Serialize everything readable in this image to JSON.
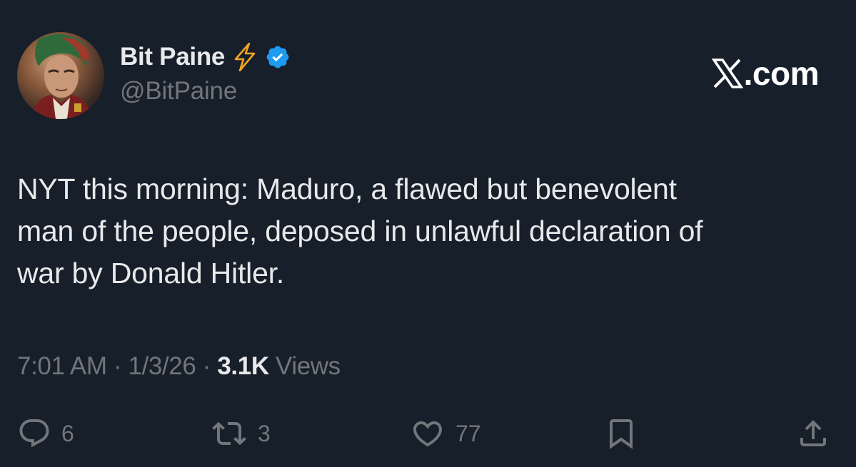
{
  "author": {
    "display_name": "Bit Paine",
    "handle": "@BitPaine",
    "badge_icon": "lightning-bolt-icon",
    "verified_icon": "verified-badge-icon",
    "avatar": "avatar-image"
  },
  "brand": {
    "label": ".com",
    "icon": "x-logo-icon"
  },
  "tweet": {
    "text": "NYT this morning: Maduro, a flawed but benevolent\nman of the people, deposed in unlawful declaration of\nwar by Donald Hitler.",
    "time": "7:01 AM",
    "date": "1/3/26",
    "separator": " · ",
    "views_count": "3.1K",
    "views_label": "Views"
  },
  "actions": {
    "replies": "6",
    "reposts": "3",
    "likes": "77"
  },
  "colors": {
    "background": "#171f2a",
    "primary_text": "#e7e9ea",
    "secondary_text": "#71767b",
    "verified_blue": "#1d9bf0",
    "bolt_orange": "#f5a623"
  }
}
